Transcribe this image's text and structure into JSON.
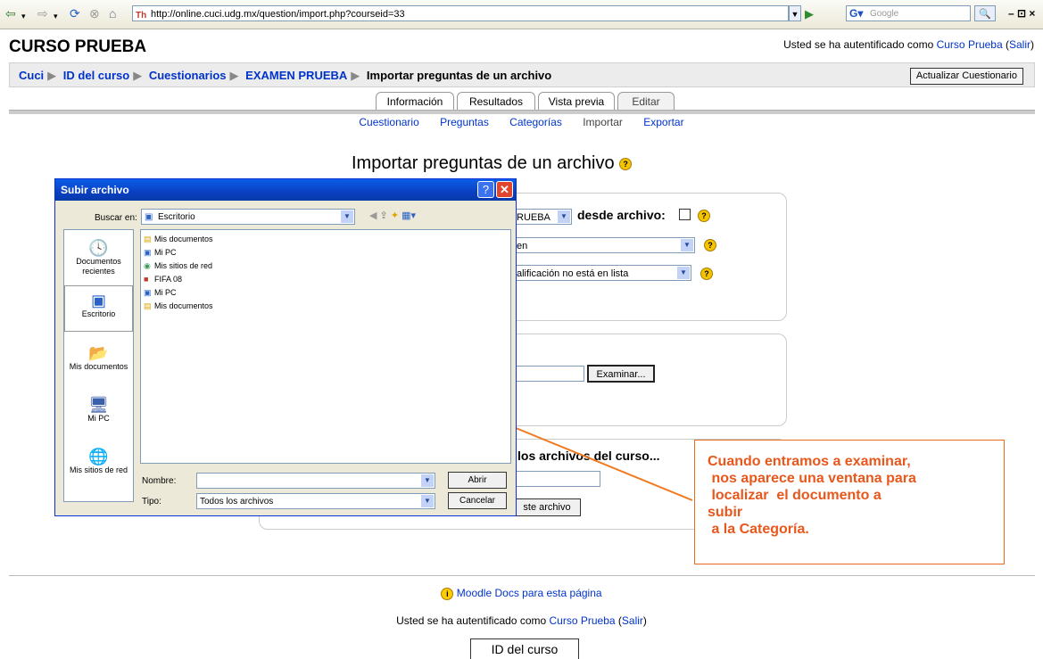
{
  "browser": {
    "url": "http://online.cuci.udg.mx/question/import.php?courseid=33",
    "search_placeholder": "Google"
  },
  "site": {
    "title": "CURSO PRUEBA",
    "login_prefix": "Usted se ha autentificado como",
    "user": "Curso Prueba",
    "logout": "Salir"
  },
  "breadcrumb": {
    "items": [
      "Cuci",
      "ID del curso",
      "Cuestionarios",
      "EXAMEN PRUEBA"
    ],
    "current": "Importar preguntas de un archivo",
    "update_button": "Actualizar Cuestionario"
  },
  "tabs": [
    "Información",
    "Resultados",
    "Vista previa",
    "Editar"
  ],
  "subtabs": [
    "Cuestionario",
    "Preguntas",
    "Categorías",
    "Importar",
    "Exportar"
  ],
  "heading": "Importar preguntas de un archivo",
  "form": {
    "category_select": "RUEBA",
    "from_file_label": "desde archivo:",
    "format_select": "en",
    "grade_select": "alificación no está en lista",
    "browse_button": "Examinar...",
    "course_files_label": "los archivos del curso...",
    "upload_button": "ste archivo"
  },
  "dialog": {
    "title": "Subir archivo",
    "look_in_label": "Buscar en:",
    "look_in_value": "Escritorio",
    "places": [
      "Documentos recientes",
      "Escritorio",
      "Mis documentos",
      "Mi PC",
      "Mis sitios de red"
    ],
    "files": [
      "Mis documentos",
      "Mi PC",
      "Mis sitios de red",
      "FIFA 08",
      "Mi PC",
      "Mis documentos"
    ],
    "name_label": "Nombre:",
    "name_value": "",
    "type_label": "Tipo:",
    "type_value": "Todos los archivos",
    "open_button": "Abrir",
    "cancel_button": "Cancelar"
  },
  "callout": {
    "lines": [
      "Cuando entramos a examinar,",
      " nos aparece una ventana para",
      " localizar  el documento a",
      "subir",
      " a la Categoría."
    ],
    "color": "#e8571b"
  },
  "footer": {
    "docs_link": "Moodle Docs para esta página",
    "login_prefix": "Usted se ha autentificado como",
    "user": "Curso Prueba",
    "logout": "Salir",
    "course_button": "ID del curso"
  }
}
